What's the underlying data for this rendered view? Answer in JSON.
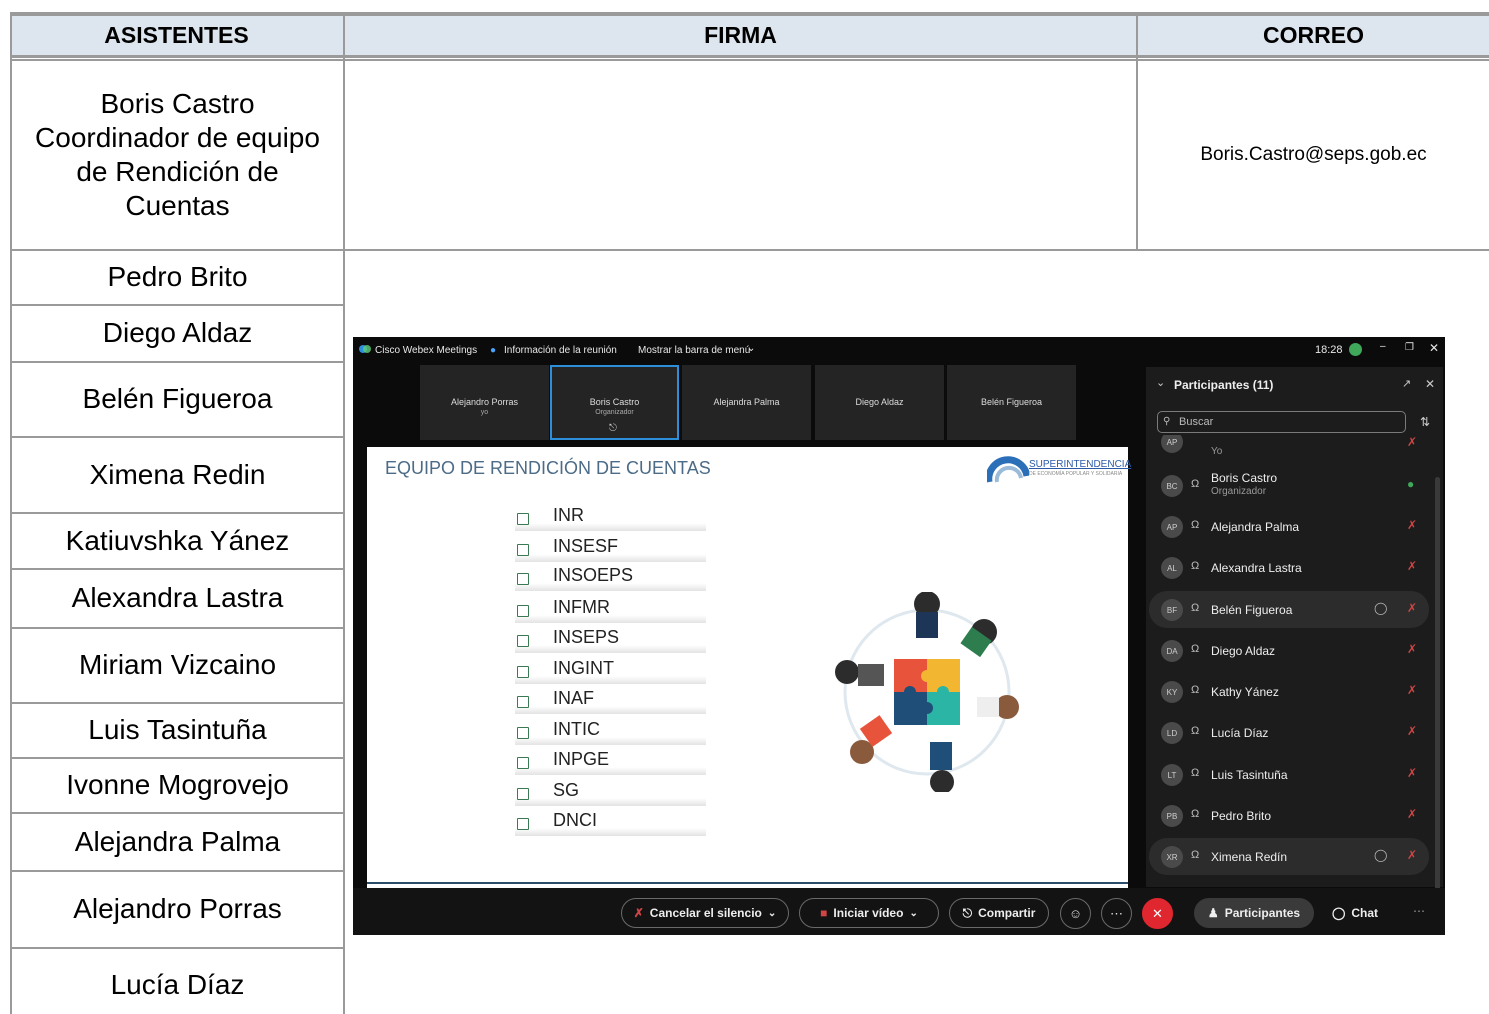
{
  "table": {
    "headers": {
      "asistentes": "ASISTENTES",
      "firma": "FIRMA",
      "correo": "CORREO"
    },
    "first_row": {
      "name_lines": [
        "Boris Castro",
        "Coordinador de equipo",
        "de Rendición de",
        "Cuentas"
      ],
      "email": "Boris.Castro@seps.gob.ec"
    },
    "attendees": [
      "Pedro Brito",
      "Diego Aldaz",
      "Belén Figueroa",
      "Ximena Redin",
      "Katiuvshka Yánez",
      "Alexandra Lastra",
      "Miriam Vizcaino",
      "Luis Tasintuña",
      "Ivonne Mogrovejo",
      "Alejandra Palma",
      "Alejandro Porras",
      "Lucía Díaz"
    ]
  },
  "webex": {
    "app_name": "Cisco Webex Meetings",
    "meeting_info": "Información de la reunión",
    "menu_bar": "Mostrar la barra de menú",
    "time": "18:28",
    "thumbs": [
      {
        "name": "Alejandro Porras",
        "sub": "yo"
      },
      {
        "name": "Boris Castro",
        "sub": "Organizador"
      },
      {
        "name": "Alejandra Palma",
        "sub": ""
      },
      {
        "name": "Diego Aldaz",
        "sub": ""
      },
      {
        "name": "Belén Figueroa",
        "sub": ""
      }
    ],
    "slide": {
      "title": "EQUIPO DE RENDICIÓN DE CUENTAS",
      "logo": "SUPERINTENDENCIA",
      "logo_sub": "DE ECONOMÍA POPULAR Y SOLIDARIA",
      "items": [
        "INR",
        "INSESF",
        "INSOEPS",
        "INFMR",
        "INSEPS",
        "INGINT",
        "INAF",
        "INTIC",
        "INPGE",
        "SG",
        "DNCI"
      ]
    },
    "panel": {
      "title": "Participantes (11)",
      "search_placeholder": "Buscar",
      "participants": [
        {
          "initials": "AP",
          "name": "",
          "sub": "Yo",
          "mic": "muted"
        },
        {
          "initials": "BC",
          "name": "Boris Castro",
          "sub": "Organizador",
          "mic": "on"
        },
        {
          "initials": "AP",
          "name": "Alejandra Palma",
          "sub": "",
          "mic": "muted"
        },
        {
          "initials": "AL",
          "name": "Alexandra Lastra",
          "sub": "",
          "mic": "muted"
        },
        {
          "initials": "BF",
          "name": "Belén Figueroa",
          "sub": "",
          "mic": "muted"
        },
        {
          "initials": "DA",
          "name": "Diego Aldaz",
          "sub": "",
          "mic": "muted"
        },
        {
          "initials": "KY",
          "name": "Kathy Yánez",
          "sub": "",
          "mic": "muted"
        },
        {
          "initials": "LD",
          "name": "Lucía Díaz",
          "sub": "",
          "mic": "muted"
        },
        {
          "initials": "LT",
          "name": "Luis Tasintuña",
          "sub": "",
          "mic": "muted"
        },
        {
          "initials": "PB",
          "name": "Pedro Brito",
          "sub": "",
          "mic": "muted"
        },
        {
          "initials": "XR",
          "name": "Ximena Redín",
          "sub": "",
          "mic": "muted"
        }
      ]
    },
    "controls": {
      "unmute": "Cancelar el silencio",
      "video": "Iniciar vídeo",
      "share": "Compartir",
      "participants": "Participantes",
      "chat": "Chat"
    },
    "colors": {
      "accent": "#2d8ed9",
      "end_call": "#e0262f",
      "mic_muted": "#d04545",
      "mic_on": "#3fa85a"
    }
  }
}
